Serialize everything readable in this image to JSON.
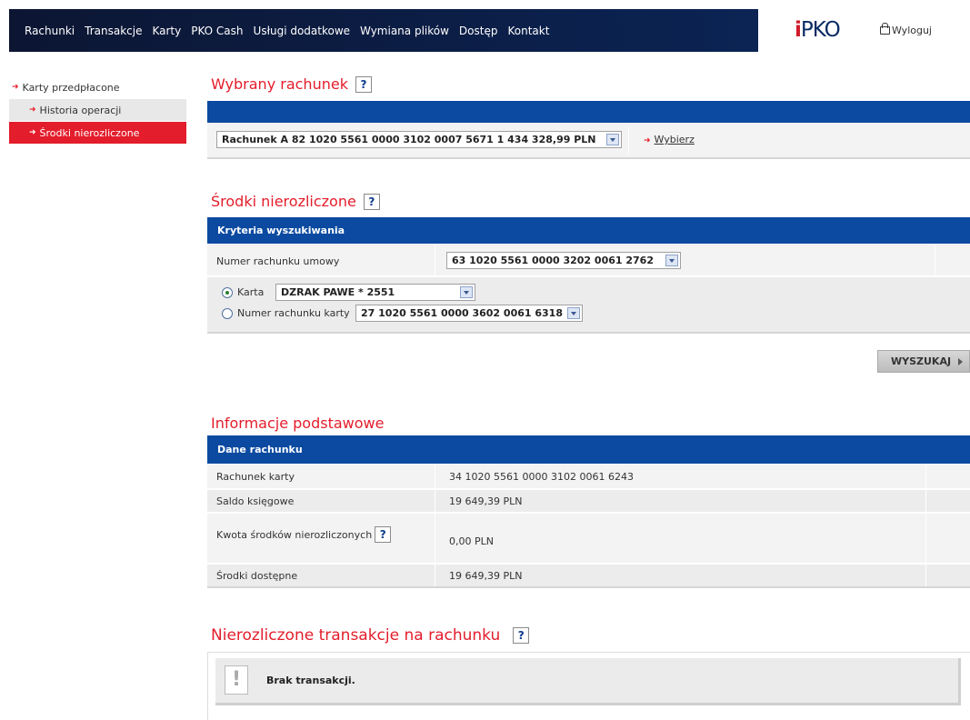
{
  "nav": {
    "items": [
      "Rachunki",
      "Transakcje",
      "Karty",
      "PKO Cash",
      "Usługi dodatkowe",
      "Wymiana plików",
      "Dostęp",
      "Kontakt"
    ],
    "logo_i": "i",
    "logo_text": "PKO",
    "logout": "Wyloguj"
  },
  "sidebar": {
    "items": [
      {
        "label": "Karty przedpłacone",
        "level": 1,
        "active": false
      },
      {
        "label": "Historia operacji",
        "level": 2,
        "active": false
      },
      {
        "label": "Środki nierozliczone",
        "level": 2,
        "active": true
      }
    ]
  },
  "account_section": {
    "title": "Wybrany rachunek",
    "help": "?",
    "selected_account": "Rachunek A  82 1020 5561 0000 3102 0007 5671  1 434 328,99 PLN",
    "choose_link": "Wybierz"
  },
  "funds_section": {
    "title": "Środki nierozliczone",
    "help": "?",
    "criteria_header": "Kryteria wyszukiwania",
    "contract_label": "Numer rachunku umowy",
    "contract_value": "63 1020 5561 0000 3202 0061 2762",
    "card_label": "Karta",
    "card_value": "DZRAK PAWE * 2551",
    "card_account_label": "Numer rachunku karty",
    "card_account_value": "27 1020 5561 0000 3602 0061 6318",
    "search_button": "WYSZUKAJ"
  },
  "info_section": {
    "title": "Informacje podstawowe",
    "header": "Dane rachunku",
    "rows": [
      {
        "label": "Rachunek karty",
        "value": "34 1020 5561 0000 3102 0061 6243"
      },
      {
        "label": "Saldo księgowe",
        "value": "19 649,39 PLN"
      },
      {
        "label": "Kwota środków nierozliczonych",
        "value": "0,00 PLN"
      },
      {
        "label": "Środki dostępne",
        "value": "19 649,39 PLN"
      }
    ],
    "help": "?"
  },
  "transactions_section": {
    "title": "Nierozliczone transakcje na rachunku",
    "help": "?",
    "empty_message": "Brak transakcji.",
    "warn_symbol": "!"
  },
  "colors": {
    "accent_red": "#e31d2b",
    "header_blue": "#0b4aa0",
    "nav_dark": "#0c1633"
  }
}
